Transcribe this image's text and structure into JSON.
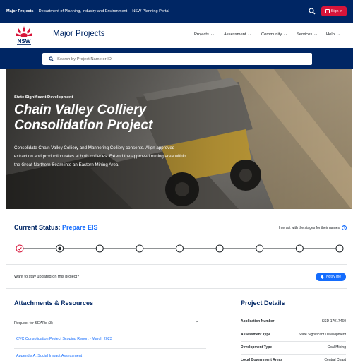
{
  "topbar": {
    "links": [
      "Major Projects",
      "Department of Planning, Industry and Environment",
      "NSW Planning Portal"
    ],
    "search_icon": "search-icon",
    "signin_label": "Sign in",
    "bg_color": "#002664",
    "signin_color": "#d7153a"
  },
  "header": {
    "logo_text": "NSW",
    "site_title": "Major Projects",
    "nav": [
      "Projects",
      "Assessment",
      "Community",
      "Services",
      "Help"
    ]
  },
  "search": {
    "placeholder": "Search by Project Name or ID"
  },
  "hero": {
    "eyebrow": "State Significant Development",
    "title": "Chain Valley Colliery Consolidation Project",
    "description": "Consolidate Chain Valley Colliery and Mannering Colliery consents. Align approved extraction and production rates at both collieries. Extend the approved mining area within the Great Northern Seam into an Eastern Mining Area."
  },
  "status": {
    "label": "Current Status:",
    "value": "Prepare EIS",
    "interact_text": "Interact with the stages for their names",
    "total_steps": 9,
    "completed_step": 1,
    "current_step": 2,
    "accent": "#146cfd"
  },
  "notify": {
    "text": "Want to stay updated on this project?",
    "button_label": "Notify me"
  },
  "attachments": {
    "title": "Attachments & Resources",
    "accordion_label": "Request for SEARs (3)",
    "links": [
      "CVC Consolidation Project Scoping Report - March 2023",
      "Appendix A: Social Impact Assessment"
    ]
  },
  "details": {
    "title": "Project Details",
    "rows": [
      {
        "key": "Application Number",
        "value": "SSD-17017460"
      },
      {
        "key": "Assessment Type",
        "value": "State Significant Development"
      },
      {
        "key": "Development Type",
        "value": "Coal Mining"
      },
      {
        "key": "Local Government Areas",
        "value": "Central Coast"
      }
    ]
  }
}
